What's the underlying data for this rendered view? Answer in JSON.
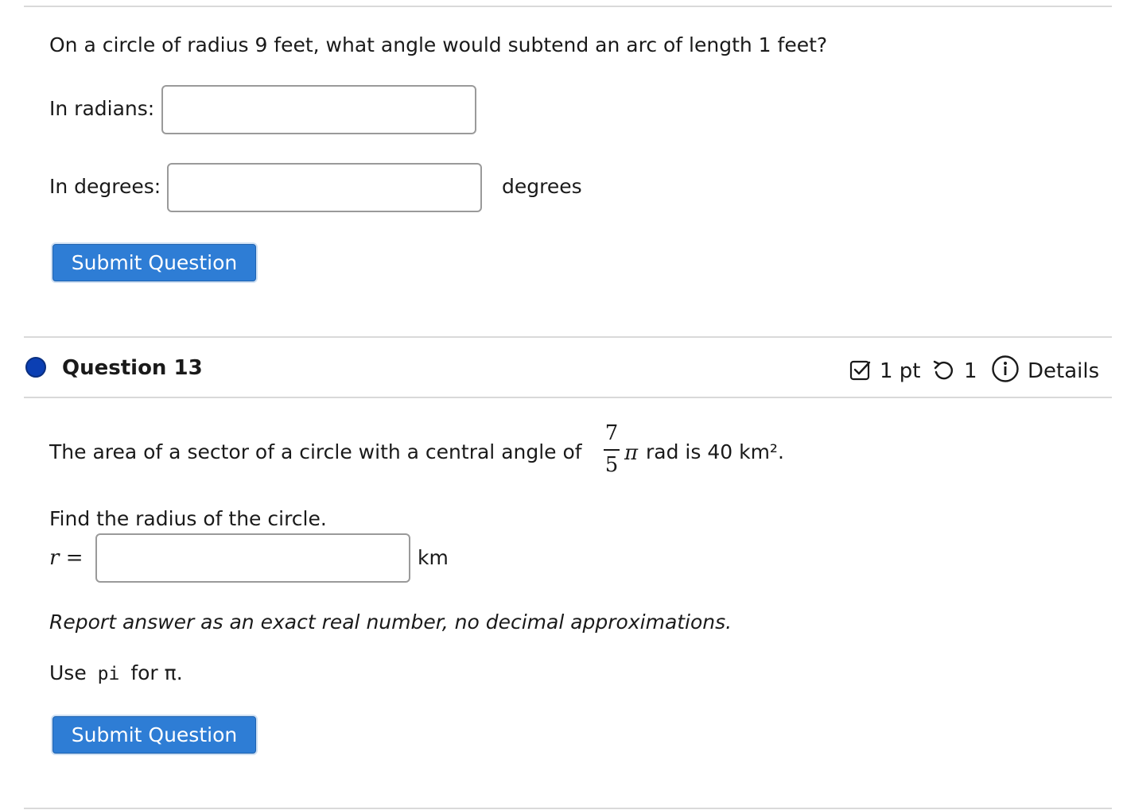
{
  "question12": {
    "prompt": "On a circle of radius 9 feet, what angle would subtend an arc of length 1 feet?",
    "radians_label": "In radians:",
    "radians_value": "",
    "degrees_label": "In degrees:",
    "degrees_value": "",
    "degrees_unit": "degrees",
    "submit_label": "Submit Question"
  },
  "question13": {
    "title": "Question 13",
    "points": "1 pt",
    "attempts": "1",
    "details_label": "Details",
    "status_color": "#0b3fb3",
    "prompt_before": "The area of a sector of a circle with a central angle of",
    "frac_numerator": "7",
    "frac_denominator": "5",
    "pi_symbol": "π",
    "prompt_after": "rad is 40 km².",
    "find_label": "Find the radius of the circle.",
    "r_label": "r =",
    "r_value": "",
    "r_unit": "km",
    "note": "Report answer as an exact real number, no decimal approximations.",
    "use_prefix": "Use",
    "use_code": "pi",
    "use_suffix": "for π.",
    "submit_label": "Submit Question"
  },
  "icons": {
    "points": "checkbox-icon",
    "attempts": "retry-icon",
    "details": "info-icon"
  },
  "colors": {
    "button": "#2e7dd5",
    "divider": "#d9d9d9"
  }
}
